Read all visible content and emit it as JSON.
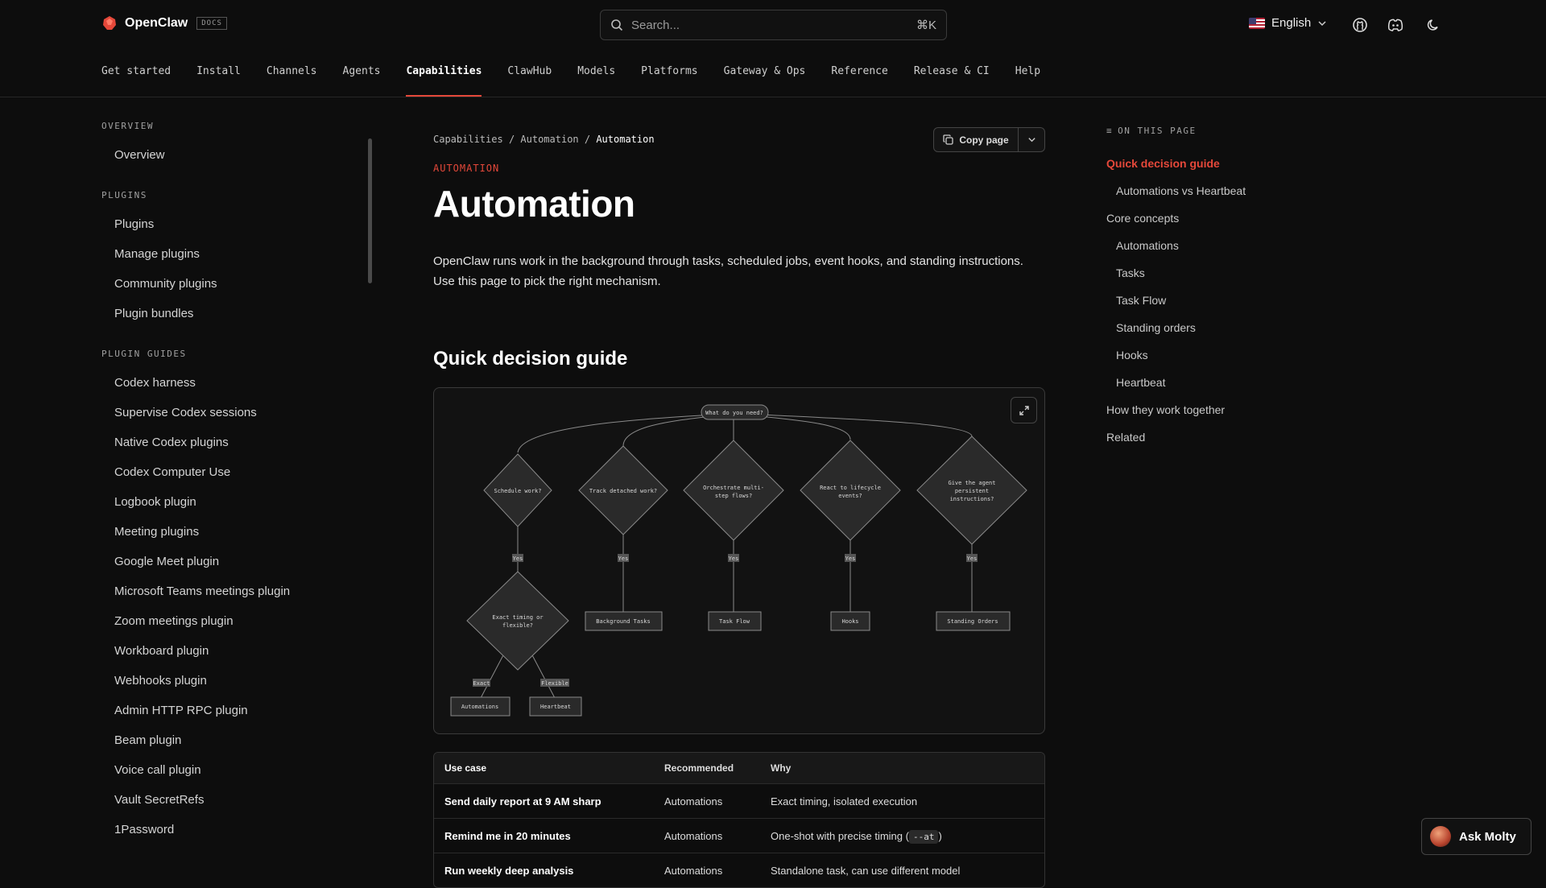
{
  "header": {
    "brand": "OpenClaw",
    "docs_badge": "DOCS",
    "search_placeholder": "Search...",
    "search_shortcut": "⌘K",
    "language": "English"
  },
  "nav": {
    "tabs": [
      "Get started",
      "Install",
      "Channels",
      "Agents",
      "Capabilities",
      "ClawHub",
      "Models",
      "Platforms",
      "Gateway & Ops",
      "Reference",
      "Release & CI",
      "Help"
    ],
    "active": "Capabilities"
  },
  "sidebar": {
    "sections": [
      {
        "title": "OVERVIEW",
        "items": [
          "Overview"
        ]
      },
      {
        "title": "PLUGINS",
        "items": [
          "Plugins",
          "Manage plugins",
          "Community plugins",
          "Plugin bundles"
        ]
      },
      {
        "title": "PLUGIN GUIDES",
        "items": [
          "Codex harness",
          "Supervise Codex sessions",
          "Native Codex plugins",
          "Codex Computer Use",
          "Logbook plugin",
          "Meeting plugins",
          "Google Meet plugin",
          "Microsoft Teams meetings plugin",
          "Zoom meetings plugin",
          "Workboard plugin",
          "Webhooks plugin",
          "Admin HTTP RPC plugin",
          "Beam plugin",
          "Voice call plugin",
          "Vault SecretRefs",
          "1Password"
        ]
      }
    ]
  },
  "main": {
    "breadcrumb": [
      "Capabilities",
      "Automation",
      "Automation"
    ],
    "copy_label": "Copy page",
    "eyebrow": "AUTOMATION",
    "title": "Automation",
    "intro": "OpenClaw runs work in the background through tasks, scheduled jobs, event hooks, and standing instructions. Use this page to pick the right mechanism.",
    "section_title": "Quick decision guide"
  },
  "diagram": {
    "root": "What do you need?",
    "questions": [
      "Schedule work?",
      "Track detached work?",
      "Orchestrate multi-step flows?",
      "React to lifecycle events?",
      "Give the agent persistent instructions?"
    ],
    "yes_label": "Yes",
    "sub_question": "Exact timing or flexible?",
    "branch_labels": [
      "Exact",
      "Flexible"
    ],
    "outcomes": [
      "Automations",
      "Heartbeat",
      "Background Tasks",
      "Task Flow",
      "Hooks",
      "Standing Orders"
    ]
  },
  "table": {
    "headers": [
      "Use case",
      "Recommended",
      "Why"
    ],
    "rows": [
      {
        "use_case": "Send daily report at 9 AM sharp",
        "recommended": "Automations",
        "why": "Exact timing, isolated execution",
        "code": ""
      },
      {
        "use_case": "Remind me in 20 minutes",
        "recommended": "Automations",
        "why": "One-shot with precise timing (",
        "code": "--at",
        "why_end": ")"
      },
      {
        "use_case": "Run weekly deep analysis",
        "recommended": "Automations",
        "why": "Standalone task, can use different model",
        "code": ""
      }
    ]
  },
  "toc": {
    "title": "ON THIS PAGE",
    "items": [
      {
        "label": "Quick decision guide",
        "level": 1,
        "active": true
      },
      {
        "label": "Automations vs Heartbeat",
        "level": 2
      },
      {
        "label": "Core concepts",
        "level": 1
      },
      {
        "label": "Automations",
        "level": 2
      },
      {
        "label": "Tasks",
        "level": 2
      },
      {
        "label": "Task Flow",
        "level": 2
      },
      {
        "label": "Standing orders",
        "level": 2
      },
      {
        "label": "Hooks",
        "level": 2
      },
      {
        "label": "Heartbeat",
        "level": 2
      },
      {
        "label": "How they work together",
        "level": 1
      },
      {
        "label": "Related",
        "level": 1
      }
    ]
  },
  "ask_button": "Ask Molty",
  "colors": {
    "accent": "#e5483a",
    "background": "#0d0d0d"
  }
}
